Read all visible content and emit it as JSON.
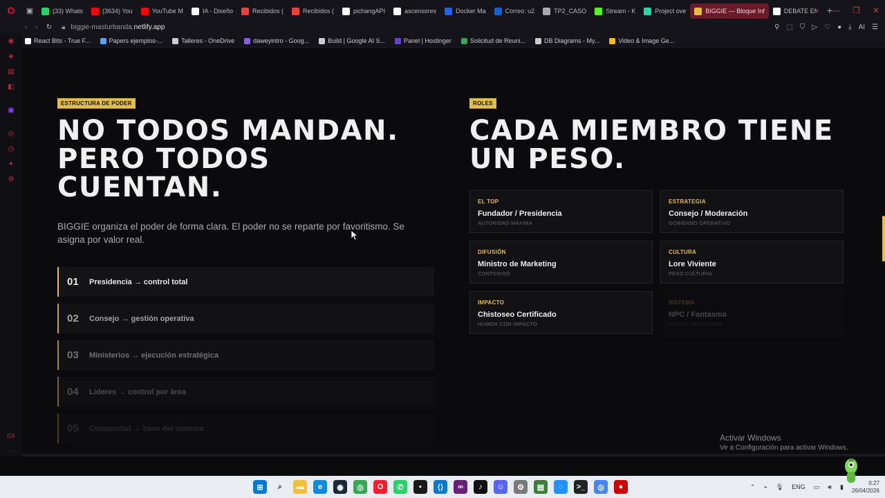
{
  "browser": {
    "tabs": [
      {
        "label": "(33) Whats",
        "color": "#25d366"
      },
      {
        "label": "(3634) You",
        "color": "#ff0000"
      },
      {
        "label": "YouTube M",
        "color": "#ff0000"
      },
      {
        "label": "IA - Diseño",
        "color": "#ffffff"
      },
      {
        "label": "Recibidos (",
        "color": "#ea4335"
      },
      {
        "label": "Recibidos (",
        "color": "#ea4335"
      },
      {
        "label": "pichangAPI",
        "color": "#ffffff"
      },
      {
        "label": "ascensores",
        "color": "#ffffff"
      },
      {
        "label": "Docker Ma",
        "color": "#1d63ed"
      },
      {
        "label": "Correo: u2",
        "color": "#0a64d8"
      },
      {
        "label": "TP2_CASO",
        "color": "#aaaaaa"
      },
      {
        "label": "Stream - K",
        "color": "#53fc18"
      },
      {
        "label": "Project ove",
        "color": "#2bd4a4"
      },
      {
        "label": "BIGGIE — Bloque Inf",
        "color": "#e4bd47"
      },
      {
        "label": "DEBATE EN",
        "color": "#ffffff"
      }
    ],
    "active_tab_index": 13,
    "url_prefix": "biggie-masturbanda.",
    "url_domain": "netlify.app"
  },
  "bookmarks": [
    {
      "label": "React Bits - True F...",
      "color": "#ffffff"
    },
    {
      "label": "Papers ejemplos-...",
      "color": "#4aa8ff"
    },
    {
      "label": "Talleres - OneDrive",
      "color": "#cccccc"
    },
    {
      "label": "daweyintro - Goog...",
      "color": "#8a5cf6"
    },
    {
      "label": "Build | Google AI S...",
      "color": "#cccccc"
    },
    {
      "label": "Panel | Hostinger",
      "color": "#673de6"
    },
    {
      "label": "Solicitud de Reuni...",
      "color": "#34a853"
    },
    {
      "label": "DB Diagrams - My...",
      "color": "#cccccc"
    },
    {
      "label": "Video & Image Ge...",
      "color": "#fbbc04"
    }
  ],
  "left": {
    "eyebrow": "ESTRUCTURA DE PODER",
    "headline_1": "NO TODOS MANDAN.",
    "headline_2": "PERO TODOS CUENTAN.",
    "lead": "BIGGIE organiza el poder de forma clara. El poder no se reparte por favoritismo. Se asigna por valor real.",
    "steps": [
      {
        "num": "01",
        "text": "Presidencia → control total"
      },
      {
        "num": "02",
        "text": "Consejo → gestión operativa"
      },
      {
        "num": "03",
        "text": "Ministerios → ejecución estratégica"
      },
      {
        "num": "04",
        "text": "Líderes → control por área"
      },
      {
        "num": "05",
        "text": "Comunidad → base del sistema"
      }
    ]
  },
  "right": {
    "eyebrow": "ROLES",
    "headline_1": "CADA MIEMBRO TIENE",
    "headline_2": "UN PESO.",
    "roles": [
      {
        "kicker": "EL TOP",
        "title": "Fundador / Presidencia",
        "sub": "AUTORIDAD MÁXIMA"
      },
      {
        "kicker": "ESTRATEGIA",
        "title": "Consejo / Moderación",
        "sub": "GOBIERNO OPERATIVO"
      },
      {
        "kicker": "DIFUSIÓN",
        "title": "Ministro de Marketing",
        "sub": "CONTENIDO"
      },
      {
        "kicker": "CULTURA",
        "title": "Lore Viviente",
        "sub": "PESO CULTURAL"
      },
      {
        "kicker": "IMPACTO",
        "title": "Chistoseo Certificado",
        "sub": "HUMOR CON IMPACTO"
      },
      {
        "kicker": "SISTEMA",
        "title": "NPC / Fantasma",
        "sub": "EXISTE, NO APORTA"
      }
    ]
  },
  "windows": {
    "activate_title": "Activar Windows",
    "activate_sub": "Ve a Configuración para activar Windows.",
    "lang": "ENG",
    "time": "0:27",
    "date": "26/04/2026"
  },
  "accent": "#e4bd47"
}
